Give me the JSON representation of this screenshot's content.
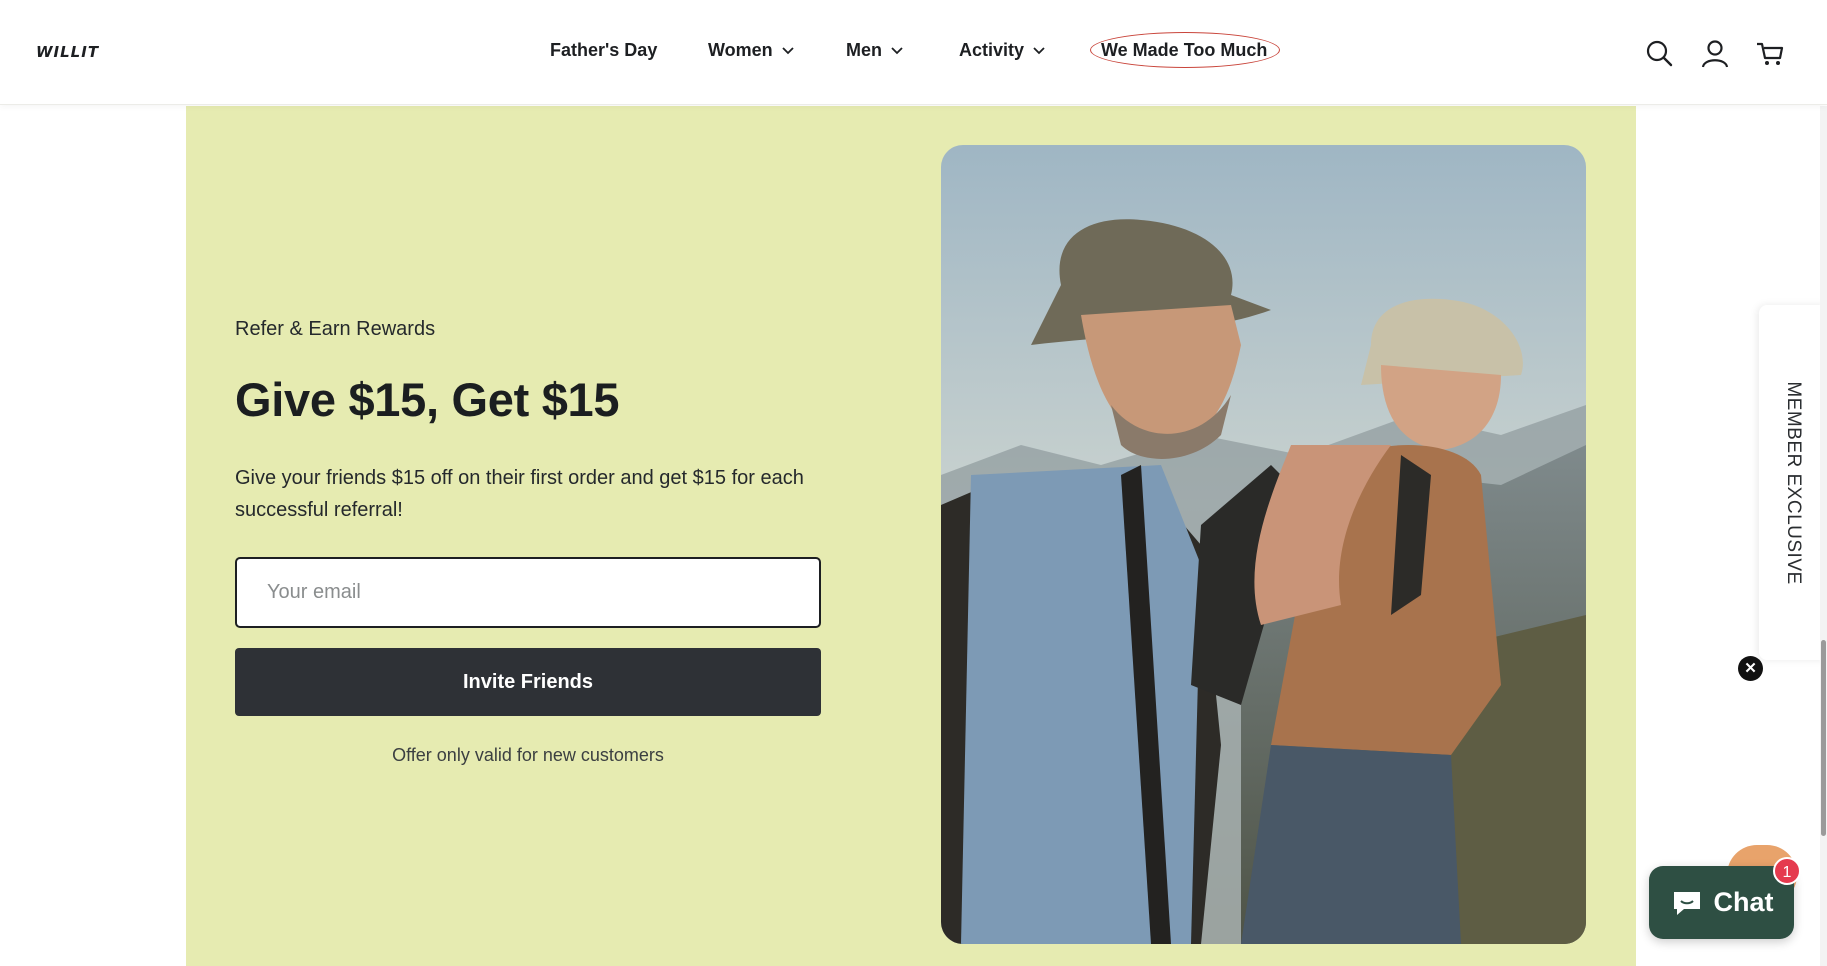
{
  "header": {
    "logo": "WILLIT",
    "nav": [
      {
        "label": "Father's Day",
        "has_dropdown": false
      },
      {
        "label": "Women",
        "has_dropdown": true
      },
      {
        "label": "Men",
        "has_dropdown": true
      },
      {
        "label": "Activity",
        "has_dropdown": true
      },
      {
        "label": "We Made Too Much",
        "has_dropdown": false,
        "highlight_color": "#c9453b"
      }
    ],
    "icons": [
      "search-icon",
      "account-icon",
      "cart-icon"
    ]
  },
  "promo": {
    "eyebrow": "Refer & Earn Rewards",
    "headline": "Give $15, Get $15",
    "description": "Give your friends $15 off on their first order and get $15 for each successful referral!",
    "email_placeholder": "Your email",
    "email_value": "",
    "button_label": "Invite Friends",
    "note": "Offer only valid for new customers",
    "background_color": "#e6ebb1",
    "button_color": "#2e3136"
  },
  "side_tab": {
    "label": "MEMBER EXCLUSIVE",
    "close_glyph": "✕"
  },
  "chat": {
    "label": "Chat",
    "badge_count": "1",
    "color": "#2e4f43",
    "badge_color": "#e53a4e"
  }
}
